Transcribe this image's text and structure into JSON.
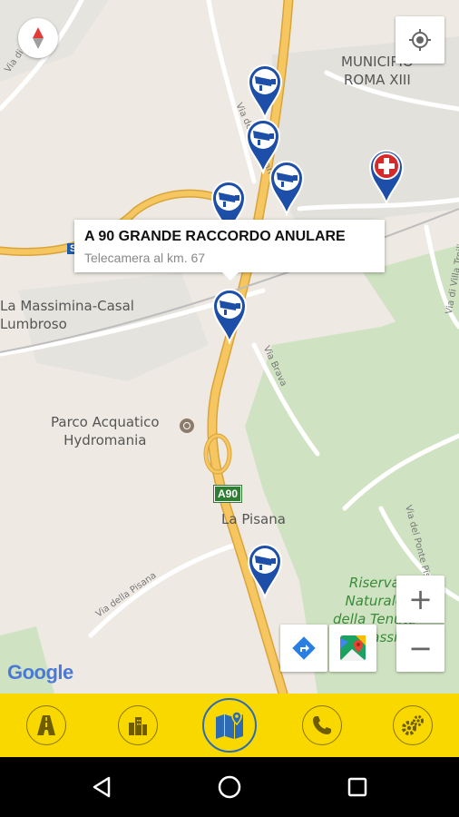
{
  "map": {
    "place_labels": {
      "municipio": "MUNICIPIO\nROMA XIII",
      "massimina": "La Massimina-Casal\nLumbroso",
      "parco": "Parco Acquatico\nHydromania",
      "pisana": "La Pisana",
      "riserva": "Riserva\nNaturale\ndella Tenuta\ndei Massimi"
    },
    "street_labels": {
      "via_di": "Via di",
      "via_magliana": "Via della Magliana",
      "via_brava": "Via Brava",
      "via_tosi": "Via di Villa Troili",
      "via_pisana": "Via della Pisana",
      "via_ponte": "Via del Ponte Pisano"
    },
    "road_shields": {
      "a90": "A90",
      "s": "S"
    },
    "attribution": "Google",
    "popup": {
      "title": "A 90 GRANDE RACCORDO ANULARE",
      "subtitle": "Telecamera al km. 67"
    },
    "zoom_in": "+",
    "zoom_out": "−"
  },
  "colors": {
    "marker_blue": "#1e4fa8",
    "marker_red": "#d62929",
    "toolbar_yellow": "#f9d800",
    "highway_orange": "#f4c35a",
    "park_green": "#cde5c0"
  },
  "toolbar": {
    "items": [
      "road-icon",
      "city-icon",
      "map-icon",
      "phone-icon",
      "settings-icon"
    ]
  }
}
